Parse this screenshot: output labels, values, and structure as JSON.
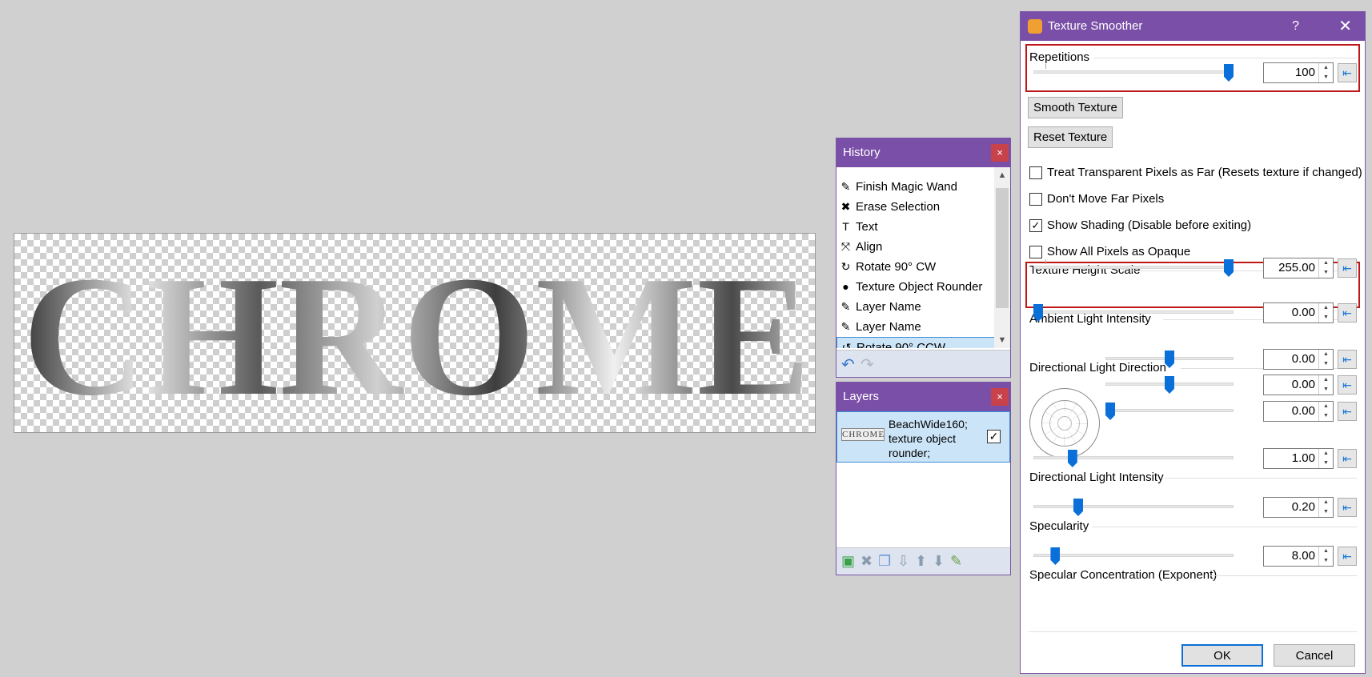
{
  "canvas": {
    "text": "CHROME"
  },
  "history": {
    "title": "History",
    "close": "×",
    "items": [
      {
        "label": "Finish Magic Wand",
        "icon": "magic-wand-icon",
        "glyph": "✎"
      },
      {
        "label": "Erase Selection",
        "icon": "red-x-icon",
        "glyph": "✖"
      },
      {
        "label": "Text",
        "icon": "text-icon",
        "glyph": "T"
      },
      {
        "label": "Align",
        "icon": "align-icon",
        "glyph": "⤧"
      },
      {
        "label": "Rotate 90° CW",
        "icon": "rotate-cw-icon",
        "glyph": "↻"
      },
      {
        "label": "Texture Object Rounder",
        "icon": "rounder-icon",
        "glyph": "●"
      },
      {
        "label": "Layer Name",
        "icon": "layer-name-icon",
        "glyph": "✎"
      },
      {
        "label": "Layer Name",
        "icon": "layer-name-icon",
        "glyph": "✎"
      },
      {
        "label": "Rotate 90° CCW",
        "icon": "rotate-ccw-icon",
        "glyph": "↺"
      }
    ],
    "footer": {
      "undo": "↶",
      "redo": "↷"
    }
  },
  "layers": {
    "title": "Layers",
    "close": "×",
    "layer_name": "BeachWide160; texture object rounder;",
    "thumb_text": "CHROME",
    "checked": "✓",
    "footer_icons": [
      "add-layer-icon",
      "delete-layer-icon",
      "duplicate-layer-icon",
      "merge-down-icon",
      "move-up-icon",
      "move-down-icon",
      "layer-properties-icon"
    ]
  },
  "dialog": {
    "title": "Texture Smoother",
    "help": "?",
    "close": "✕",
    "repetitions": {
      "label": "Repetitions",
      "value": "100",
      "fraction": 1.0
    },
    "smooth_btn": "Smooth Texture",
    "reset_btn": "Reset Texture",
    "checks": [
      {
        "label": "Treat Transparent Pixels as Far (Resets texture if changed)",
        "checked": ""
      },
      {
        "label": "Don't Move Far Pixels",
        "checked": ""
      },
      {
        "label": "Show Shading (Disable before exiting)",
        "checked": "✓"
      },
      {
        "label": "Show All Pixels as Opaque",
        "checked": ""
      }
    ],
    "height_scale": {
      "label": "Texture Height Scale",
      "value": "255.00",
      "fraction": 1.0
    },
    "ambient": {
      "label": "Ambient Light Intensity",
      "value": "0.00",
      "fraction": 0.0
    },
    "direction": {
      "label": "Directional Light Direction",
      "values": [
        "0.00",
        "0.00",
        "0.00"
      ],
      "fractions": [
        0.5,
        0.5,
        0.0
      ]
    },
    "dir_intensity": {
      "label": "Directional Light Intensity",
      "value": "1.00",
      "fraction": 0.18
    },
    "specularity": {
      "label": "Specularity",
      "value": "0.20",
      "fraction": 0.21
    },
    "spec_conc": {
      "label": "Specular Concentration (Exponent)",
      "value": "8.00",
      "fraction": 0.09
    },
    "ok": "OK",
    "cancel": "Cancel",
    "reset_glyph": "⇤",
    "spin_up": "▲",
    "spin_down": "▼"
  }
}
